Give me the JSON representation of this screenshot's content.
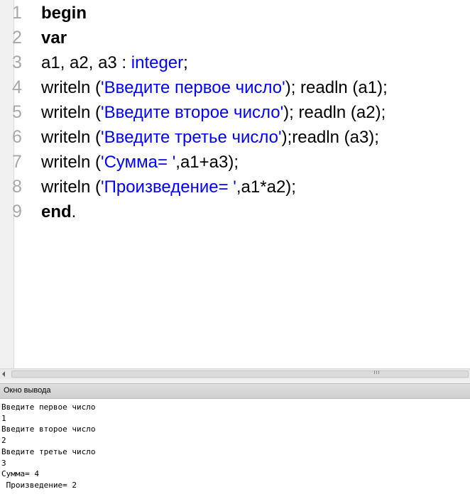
{
  "editor": {
    "lines": [
      {
        "num": "1",
        "parts": [
          {
            "text": "begin",
            "style": "kw"
          }
        ]
      },
      {
        "num": "2",
        "parts": [
          {
            "text": "var",
            "style": "kw"
          }
        ]
      },
      {
        "num": "3",
        "parts": [
          {
            "text": "a1, a2, a3 : ",
            "style": "plain"
          },
          {
            "text": "integer",
            "style": "ty"
          },
          {
            "text": ";",
            "style": "plain"
          }
        ]
      },
      {
        "num": "4",
        "parts": [
          {
            "text": "writeln (",
            "style": "plain"
          },
          {
            "text": "'Введите первое число'",
            "style": "str"
          },
          {
            "text": "); readln (a1);",
            "style": "plain"
          }
        ]
      },
      {
        "num": "5",
        "parts": [
          {
            "text": "writeln (",
            "style": "plain"
          },
          {
            "text": "'Введите второе число'",
            "style": "str"
          },
          {
            "text": "); readln (a2);",
            "style": "plain"
          }
        ]
      },
      {
        "num": "6",
        "parts": [
          {
            "text": "writeln (",
            "style": "plain"
          },
          {
            "text": "'Введите третье число'",
            "style": "str"
          },
          {
            "text": ");readln (a3);",
            "style": "plain"
          }
        ]
      },
      {
        "num": "7",
        "parts": [
          {
            "text": "writeln (",
            "style": "plain"
          },
          {
            "text": "'Сумма= '",
            "style": "str"
          },
          {
            "text": ",a1+a3);",
            "style": "plain"
          }
        ]
      },
      {
        "num": "8",
        "parts": [
          {
            "text": "writeln (",
            "style": "plain"
          },
          {
            "text": "'Произведение= '",
            "style": "str"
          },
          {
            "text": ",a1*a2);",
            "style": "plain"
          }
        ]
      },
      {
        "num": "9",
        "parts": [
          {
            "text": "end",
            "style": "kw"
          },
          {
            "text": ".",
            "style": "plain"
          }
        ]
      }
    ]
  },
  "output": {
    "title": "Окно вывода",
    "lines": [
      "Введите первое число",
      "1",
      "Введите второе число",
      "2",
      "Введите третье число",
      "3",
      "Сумма= 4",
      " Произведение= 2"
    ]
  },
  "colors": {
    "string": "#0000ff",
    "type": "#0000ff",
    "line_number": "#a8a8a8"
  }
}
